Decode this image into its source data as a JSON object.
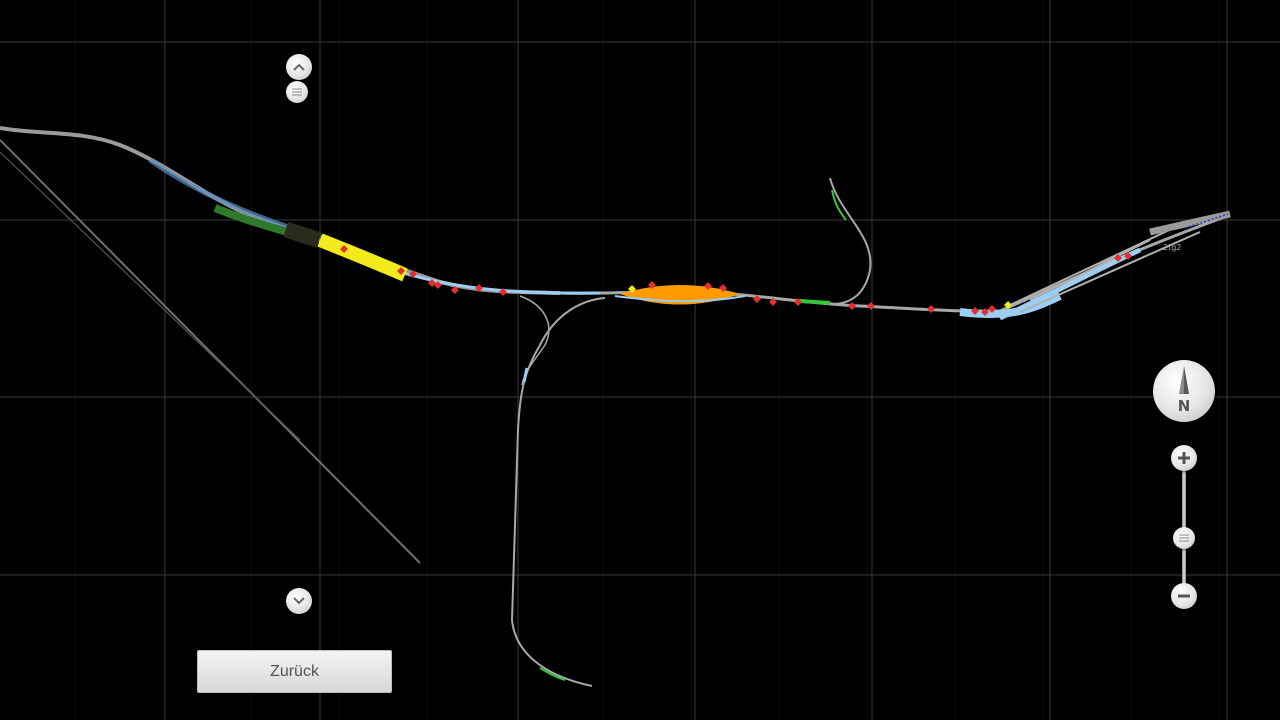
{
  "map": {
    "background_color": "#000000",
    "grid_color": "#2b2b2b",
    "grid_major_color": "#3a3a3a",
    "track_color": "#a8a8a8",
    "platform_color": "#9ccdf2",
    "signal_color": "#e23030",
    "highlight_yellow": "#f2ea1a",
    "highlight_orange": "#ff9a00",
    "highlight_green": "#36c43a",
    "track_label": "2tg2"
  },
  "controls": {
    "scroll_up_icon": "chevron-up-icon",
    "scroll_handle_icon": "slider-handle-icon",
    "scroll_down_icon": "chevron-down-icon",
    "compass_label": "N",
    "zoom_in_icon": "plus-icon",
    "zoom_out_icon": "minus-icon",
    "zoom_handle_icon": "slider-handle-icon"
  },
  "back_button": {
    "label": "Zurück"
  }
}
